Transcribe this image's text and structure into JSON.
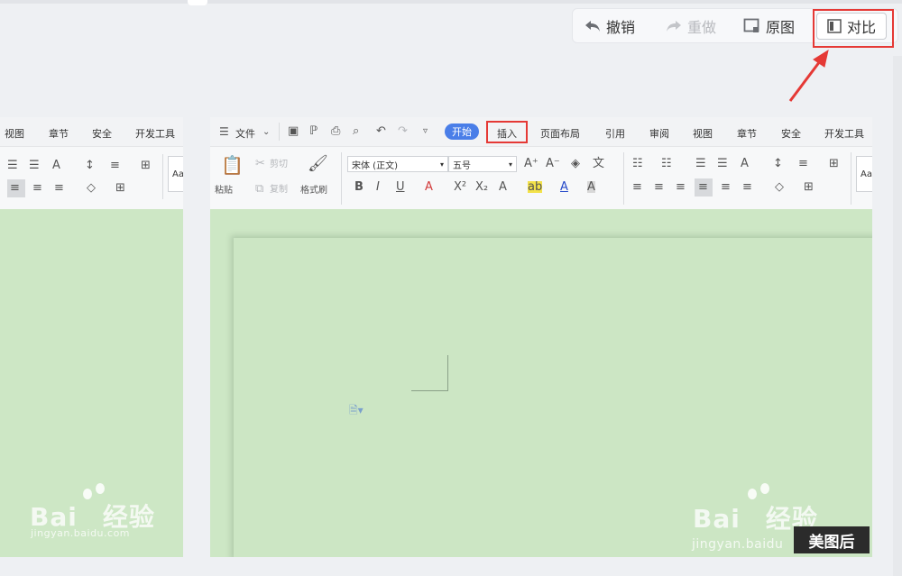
{
  "toolbar": {
    "undo_label": "撤销",
    "redo_label": "重做",
    "original_label": "原图",
    "compare_label": "对比"
  },
  "left_panel": {
    "tabs": [
      "视图",
      "章节",
      "安全",
      "开发工具"
    ],
    "style_preview": "Aa",
    "watermark": {
      "brand": "Bai",
      "brand2": "经验",
      "url": "jingyan.baidu.com"
    }
  },
  "right_panel": {
    "menu_label": "文件",
    "tabs": {
      "start": "开始",
      "insert": "插入",
      "layout": "页面布局",
      "reference": "引用",
      "review": "审阅",
      "view": "视图",
      "chapter": "章节",
      "security": "安全",
      "developer": "开发工具"
    },
    "clipboard": {
      "paste": "粘贴",
      "cut": "剪切",
      "copy": "复制",
      "format_painter": "格式刷"
    },
    "font_name": "宋体 (正文)",
    "font_size": "五号",
    "style_preview": "Aa",
    "watermark": {
      "brand": "Bai",
      "brand2": "经验",
      "url": "jingyan.baidu"
    },
    "after_label": "美图后"
  },
  "colors": {
    "accent": "#4a7ee8",
    "highlight_box": "#e53935",
    "doc_background": "#cde7c5"
  }
}
